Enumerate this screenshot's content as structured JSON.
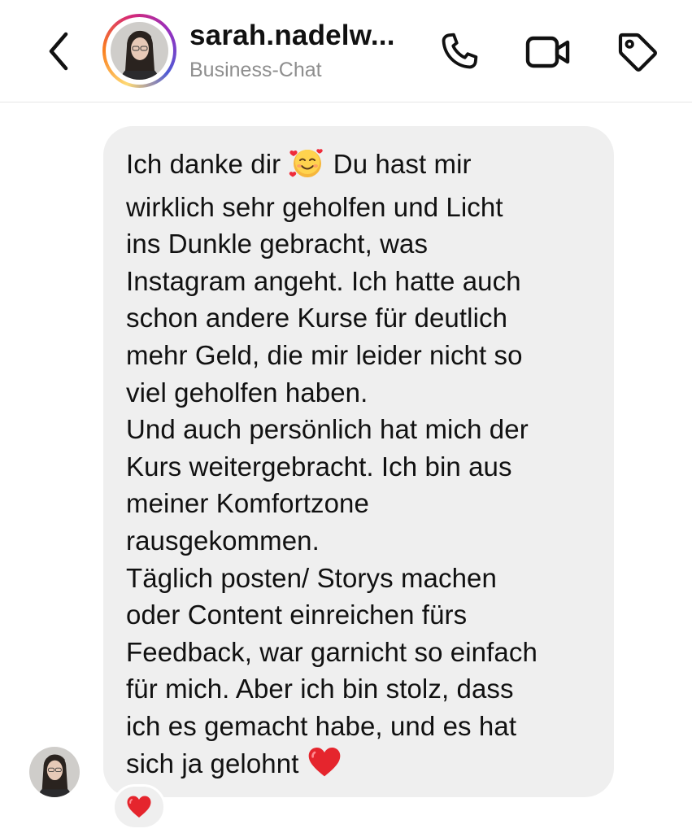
{
  "header": {
    "title": "sarah.nadelw...",
    "subtitle": "Business-Chat",
    "icons": [
      "back-chevron-icon",
      "phone-icon",
      "video-camera-icon",
      "tag-icon"
    ]
  },
  "message": {
    "lines": [
      {
        "before": "Ich danke dir ",
        "emoji": "smiling-face-with-hearts",
        "after": " Du hast mir"
      },
      {
        "text": "wirklich sehr geholfen und Licht"
      },
      {
        "text": "ins Dunkle gebracht, was"
      },
      {
        "text": "Instagram angeht. Ich hatte auch"
      },
      {
        "text": "schon andere Kurse für deutlich"
      },
      {
        "text": "mehr Geld, die mir leider nicht so"
      },
      {
        "text": "viel geholfen haben."
      },
      {
        "text": "Und auch persönlich hat mich der"
      },
      {
        "text": "Kurs weitergebracht. Ich bin aus"
      },
      {
        "text": "meiner Komfortzone"
      },
      {
        "text": "rausgekommen."
      },
      {
        "text": "Täglich posten/ Storys machen"
      },
      {
        "text": "oder Content einreichen fürs"
      },
      {
        "text": "Feedback, war garnicht so einfach"
      },
      {
        "text": "für mich. Aber ich bin stolz, dass"
      },
      {
        "text": "ich es gemacht habe, und es hat"
      },
      {
        "before": "sich ja gelohnt ",
        "emoji": "red-heart",
        "after": ""
      }
    ]
  },
  "reaction": {
    "emoji": "red-heart"
  },
  "colors": {
    "bubble": "#efefef",
    "text": "#111111",
    "subtitle": "#8e8e8e",
    "heart": "#e5252d"
  }
}
